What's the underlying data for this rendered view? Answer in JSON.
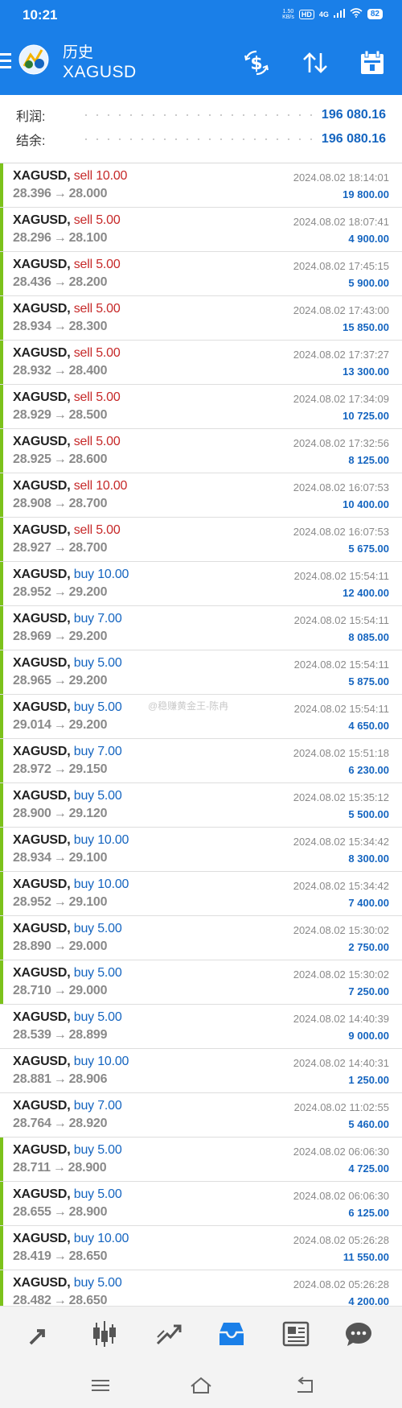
{
  "status_bar": {
    "time": "10:21",
    "net_speed": "1.50\nKB/s",
    "hd": "HD",
    "network": "4G",
    "battery": "82"
  },
  "header": {
    "title": "历史",
    "symbol": "XAGUSD"
  },
  "summary": {
    "profit_label": "利润:",
    "profit_value": "196 080.16",
    "balance_label": "结余:",
    "balance_value": "196 080.16"
  },
  "trades": [
    {
      "symbol": "XAGUSD,",
      "side": "sell",
      "lots": "10.00",
      "open": "28.396",
      "close": "28.000",
      "time": "2024.08.02 18:14:01",
      "profit": "19 800.00",
      "mark": true
    },
    {
      "symbol": "XAGUSD,",
      "side": "sell",
      "lots": "5.00",
      "open": "28.296",
      "close": "28.100",
      "time": "2024.08.02 18:07:41",
      "profit": "4 900.00",
      "mark": true
    },
    {
      "symbol": "XAGUSD,",
      "side": "sell",
      "lots": "5.00",
      "open": "28.436",
      "close": "28.200",
      "time": "2024.08.02 17:45:15",
      "profit": "5 900.00",
      "mark": true
    },
    {
      "symbol": "XAGUSD,",
      "side": "sell",
      "lots": "5.00",
      "open": "28.934",
      "close": "28.300",
      "time": "2024.08.02 17:43:00",
      "profit": "15 850.00",
      "mark": true
    },
    {
      "symbol": "XAGUSD,",
      "side": "sell",
      "lots": "5.00",
      "open": "28.932",
      "close": "28.400",
      "time": "2024.08.02 17:37:27",
      "profit": "13 300.00",
      "mark": true
    },
    {
      "symbol": "XAGUSD,",
      "side": "sell",
      "lots": "5.00",
      "open": "28.929",
      "close": "28.500",
      "time": "2024.08.02 17:34:09",
      "profit": "10 725.00",
      "mark": true
    },
    {
      "symbol": "XAGUSD,",
      "side": "sell",
      "lots": "5.00",
      "open": "28.925",
      "close": "28.600",
      "time": "2024.08.02 17:32:56",
      "profit": "8 125.00",
      "mark": true
    },
    {
      "symbol": "XAGUSD,",
      "side": "sell",
      "lots": "10.00",
      "open": "28.908",
      "close": "28.700",
      "time": "2024.08.02 16:07:53",
      "profit": "10 400.00",
      "mark": true
    },
    {
      "symbol": "XAGUSD,",
      "side": "sell",
      "lots": "5.00",
      "open": "28.927",
      "close": "28.700",
      "time": "2024.08.02 16:07:53",
      "profit": "5 675.00",
      "mark": true
    },
    {
      "symbol": "XAGUSD,",
      "side": "buy",
      "lots": "10.00",
      "open": "28.952",
      "close": "29.200",
      "time": "2024.08.02 15:54:11",
      "profit": "12 400.00",
      "mark": true
    },
    {
      "symbol": "XAGUSD,",
      "side": "buy",
      "lots": "7.00",
      "open": "28.969",
      "close": "29.200",
      "time": "2024.08.02 15:54:11",
      "profit": "8 085.00",
      "mark": true
    },
    {
      "symbol": "XAGUSD,",
      "side": "buy",
      "lots": "5.00",
      "open": "28.965",
      "close": "29.200",
      "time": "2024.08.02 15:54:11",
      "profit": "5 875.00",
      "mark": true
    },
    {
      "symbol": "XAGUSD,",
      "side": "buy",
      "lots": "5.00",
      "open": "29.014",
      "close": "29.200",
      "time": "2024.08.02 15:54:11",
      "profit": "4 650.00",
      "mark": true
    },
    {
      "symbol": "XAGUSD,",
      "side": "buy",
      "lots": "7.00",
      "open": "28.972",
      "close": "29.150",
      "time": "2024.08.02 15:51:18",
      "profit": "6 230.00",
      "mark": true
    },
    {
      "symbol": "XAGUSD,",
      "side": "buy",
      "lots": "5.00",
      "open": "28.900",
      "close": "29.120",
      "time": "2024.08.02 15:35:12",
      "profit": "5 500.00",
      "mark": true
    },
    {
      "symbol": "XAGUSD,",
      "side": "buy",
      "lots": "10.00",
      "open": "28.934",
      "close": "29.100",
      "time": "2024.08.02 15:34:42",
      "profit": "8 300.00",
      "mark": true
    },
    {
      "symbol": "XAGUSD,",
      "side": "buy",
      "lots": "10.00",
      "open": "28.952",
      "close": "29.100",
      "time": "2024.08.02 15:34:42",
      "profit": "7 400.00",
      "mark": true
    },
    {
      "symbol": "XAGUSD,",
      "side": "buy",
      "lots": "5.00",
      "open": "28.890",
      "close": "29.000",
      "time": "2024.08.02 15:30:02",
      "profit": "2 750.00",
      "mark": true
    },
    {
      "symbol": "XAGUSD,",
      "side": "buy",
      "lots": "5.00",
      "open": "28.710",
      "close": "29.000",
      "time": "2024.08.02 15:30:02",
      "profit": "7 250.00",
      "mark": true
    },
    {
      "symbol": "XAGUSD,",
      "side": "buy",
      "lots": "5.00",
      "open": "28.539",
      "close": "28.899",
      "time": "2024.08.02 14:40:39",
      "profit": "9 000.00",
      "mark": false
    },
    {
      "symbol": "XAGUSD,",
      "side": "buy",
      "lots": "10.00",
      "open": "28.881",
      "close": "28.906",
      "time": "2024.08.02 14:40:31",
      "profit": "1 250.00",
      "mark": false
    },
    {
      "symbol": "XAGUSD,",
      "side": "buy",
      "lots": "7.00",
      "open": "28.764",
      "close": "28.920",
      "time": "2024.08.02 11:02:55",
      "profit": "5 460.00",
      "mark": false
    },
    {
      "symbol": "XAGUSD,",
      "side": "buy",
      "lots": "5.00",
      "open": "28.711",
      "close": "28.900",
      "time": "2024.08.02 06:06:30",
      "profit": "4 725.00",
      "mark": true
    },
    {
      "symbol": "XAGUSD,",
      "side": "buy",
      "lots": "5.00",
      "open": "28.655",
      "close": "28.900",
      "time": "2024.08.02 06:06:30",
      "profit": "6 125.00",
      "mark": true
    },
    {
      "symbol": "XAGUSD,",
      "side": "buy",
      "lots": "10.00",
      "open": "28.419",
      "close": "28.650",
      "time": "2024.08.02 05:26:28",
      "profit": "11 550.00",
      "mark": true
    },
    {
      "symbol": "XAGUSD,",
      "side": "buy",
      "lots": "5.00",
      "open": "28.482",
      "close": "28.650",
      "time": "2024.08.02 05:26:28",
      "profit": "4 200.00",
      "mark": true
    }
  ],
  "watermark": "@稳赚黄金王-陈冉",
  "bottom_nav": [
    "quotes-icon",
    "chart-icon",
    "trade-icon",
    "history-icon",
    "news-icon",
    "messages-icon"
  ],
  "colors": {
    "accent": "#1a7fe8",
    "sell": "#c62828",
    "buy": "#1565c0",
    "mark": "#7cc21b"
  }
}
